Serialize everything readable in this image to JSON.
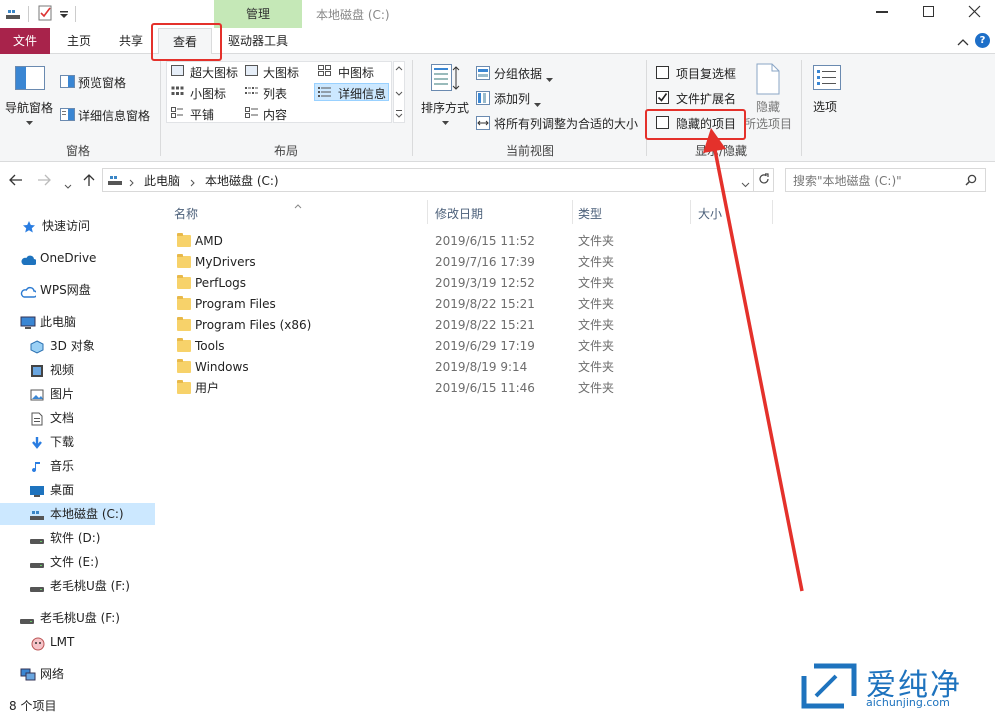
{
  "window": {
    "title": "本地磁盘 (C:)",
    "context_tab": "管理"
  },
  "tabs": [
    {
      "label": "文件"
    },
    {
      "label": "主页"
    },
    {
      "label": "共享"
    },
    {
      "label": "查看"
    },
    {
      "label": "驱动器工具"
    }
  ],
  "ribbon": {
    "panes": {
      "nav_pane": "导航窗格",
      "preview_pane": "预览窗格",
      "details_pane": "详细信息窗格",
      "label": "窗格"
    },
    "layout": {
      "items": [
        "超大图标",
        "大图标",
        "中图标",
        "小图标",
        "列表",
        "详细信息",
        "平铺",
        "内容"
      ],
      "label": "布局"
    },
    "current_view": {
      "sort_by": "排序方式",
      "group_by": "分组依据",
      "add_columns": "添加列",
      "size_all": "将所有列调整为合适的大小",
      "label": "当前视图"
    },
    "show_hide": {
      "item_checkboxes": "项目复选框",
      "file_ext": "文件扩展名",
      "hidden_items": "隐藏的项目",
      "hide_selected": "隐藏",
      "hide_selected_2": "所选项目",
      "label": "显示/隐藏"
    },
    "options": "选项"
  },
  "address": {
    "crumbs": [
      "此电脑",
      "本地磁盘 (C:)"
    ],
    "search_placeholder": "搜索\"本地磁盘 (C:)\""
  },
  "nav": [
    {
      "label": "快速访问"
    },
    {
      "label": "OneDrive"
    },
    {
      "label": "WPS网盘"
    },
    {
      "label": "此电脑"
    },
    {
      "label": "3D 对象"
    },
    {
      "label": "视频"
    },
    {
      "label": "图片"
    },
    {
      "label": "文档"
    },
    {
      "label": "下载"
    },
    {
      "label": "音乐"
    },
    {
      "label": "桌面"
    },
    {
      "label": "本地磁盘 (C:)"
    },
    {
      "label": "软件 (D:)"
    },
    {
      "label": "文件 (E:)"
    },
    {
      "label": "老毛桃U盘 (F:)"
    },
    {
      "label": "老毛桃U盘 (F:)"
    },
    {
      "label": "LMT"
    },
    {
      "label": "网络"
    }
  ],
  "columns": {
    "name": "名称",
    "date": "修改日期",
    "type": "类型",
    "size": "大小"
  },
  "files": [
    {
      "name": "AMD",
      "date": "2019/6/15 11:52",
      "type": "文件夹"
    },
    {
      "name": "MyDrivers",
      "date": "2019/7/16 17:39",
      "type": "文件夹"
    },
    {
      "name": "PerfLogs",
      "date": "2019/3/19 12:52",
      "type": "文件夹"
    },
    {
      "name": "Program Files",
      "date": "2019/8/22 15:21",
      "type": "文件夹"
    },
    {
      "name": "Program Files (x86)",
      "date": "2019/8/22 15:21",
      "type": "文件夹"
    },
    {
      "name": "Tools",
      "date": "2019/6/29 17:19",
      "type": "文件夹"
    },
    {
      "name": "Windows",
      "date": "2019/8/19 9:14",
      "type": "文件夹"
    },
    {
      "name": "用户",
      "date": "2019/6/15 11:46",
      "type": "文件夹"
    }
  ],
  "status": "8 个项目",
  "watermark": {
    "text": "爱纯净",
    "url": "aichunjing.com"
  },
  "colors": {
    "file_tab": "#a8234b",
    "context_tab": "#c5e8b7",
    "annotation": "#e4312b",
    "folder": "#f7d26a"
  }
}
